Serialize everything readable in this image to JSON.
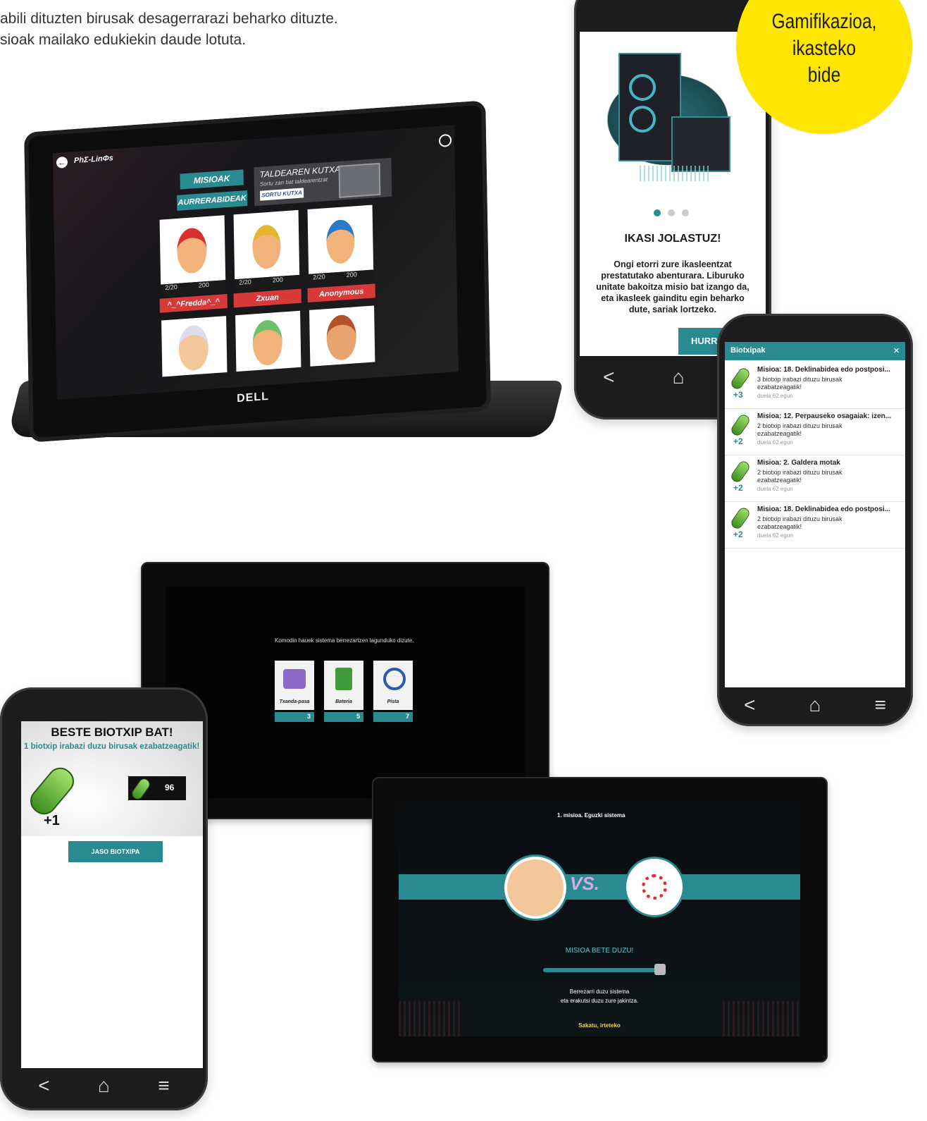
{
  "intro": {
    "line1": "abili dituzten birusak desagerrarazi beharko dituzte.",
    "line2": "sioak mailako edukiekin daude lotuta."
  },
  "badge": {
    "line1": "Gamifikazioa,",
    "line2": "ikasteko",
    "line3": "bide"
  },
  "laptop": {
    "app_logo": "PhΣ-LinΦs",
    "brand": "DELL",
    "btn_missions": "MISIOAK",
    "btn_progress": "AURRERABIDEAK",
    "box_title": "TALDEAREN KUTXA",
    "box_sub": "Sortu zan bat taldearentzat",
    "box_btn": "SORTU KUTXA",
    "cards": [
      {
        "stats": "2/20",
        "coins": "200",
        "name": "^_^Fredda^_^"
      },
      {
        "stats": "2/20",
        "coins": "200",
        "name": "Zxuan"
      },
      {
        "stats": "2/20",
        "coins": "200",
        "name": "Anonymous"
      }
    ]
  },
  "phone_top": {
    "title": "IKASI JOLASTUZ!",
    "body": "Ongi etorri zure ikasleentzat prestatutako abenturara. Liburuko unitate bakoitza misio bat izango da, eta ikasleek gainditu egin beharko dute, sariak lortzeko.",
    "next_btn": "HURR"
  },
  "phone_right": {
    "header": "Biotxipak",
    "close": "×",
    "items": [
      {
        "title": "Misioa: 18. Deklinabidea edo postposi...",
        "points": "+3",
        "desc1": "3 biotxip irabazi dituzu birusak",
        "desc2": "ezabatzeagatik!",
        "time": "duela 62 egun"
      },
      {
        "title": "Misioa: 12. Perpauseko osagaiak: izen...",
        "points": "+2",
        "desc1": "2 biotxip irabazi dituzu birusak",
        "desc2": "ezabatzeagatik!",
        "time": "duela 62 egun"
      },
      {
        "title": "Misioa: 2. Galdera motak",
        "points": "+2",
        "desc1": "2 biotxip irabazi dituzu birusak",
        "desc2": "ezabatzeagatik!",
        "time": "duela 62 egun"
      },
      {
        "title": "Misioa: 18. Deklinabidea edo postposi...",
        "points": "+2",
        "desc1": "2 biotxip irabazi dituzu birusak",
        "desc2": "ezabatzeagatik!",
        "time": "duela 62 egun"
      }
    ]
  },
  "tablet_mid": {
    "caption": "Komodin hauek sistema berrezartzen lagunduko dizute.",
    "cards": [
      {
        "label": "Txanda-pasa",
        "count": "3"
      },
      {
        "label": "Bateria",
        "count": "5"
      },
      {
        "label": "Pista",
        "count": "7"
      }
    ]
  },
  "phone_left": {
    "title": "BESTE BIOTXIP BAT!",
    "subtitle": "1 biotxip irabazi duzu birusak ezabatzeagatik!",
    "plus": "+1",
    "total": "96",
    "button": "JASO BIOTXIPA"
  },
  "tablet_bottom": {
    "mission": "1. misioa. Eguzki sistema",
    "vs": "VS.",
    "done": "MISIOA BETE DUZU!",
    "msg1": "Berrezarri duzu sistema",
    "msg2": "eta erakutsi duzu zure jakintza.",
    "exit": "Sakatu, irteteko"
  },
  "nav": {
    "back": "<",
    "home": "⌂",
    "menu": "≡"
  },
  "colors": {
    "teal": "#2a8a92",
    "badge": "#ffe600",
    "red": "#d83a3a",
    "green": "#7cc33e"
  }
}
